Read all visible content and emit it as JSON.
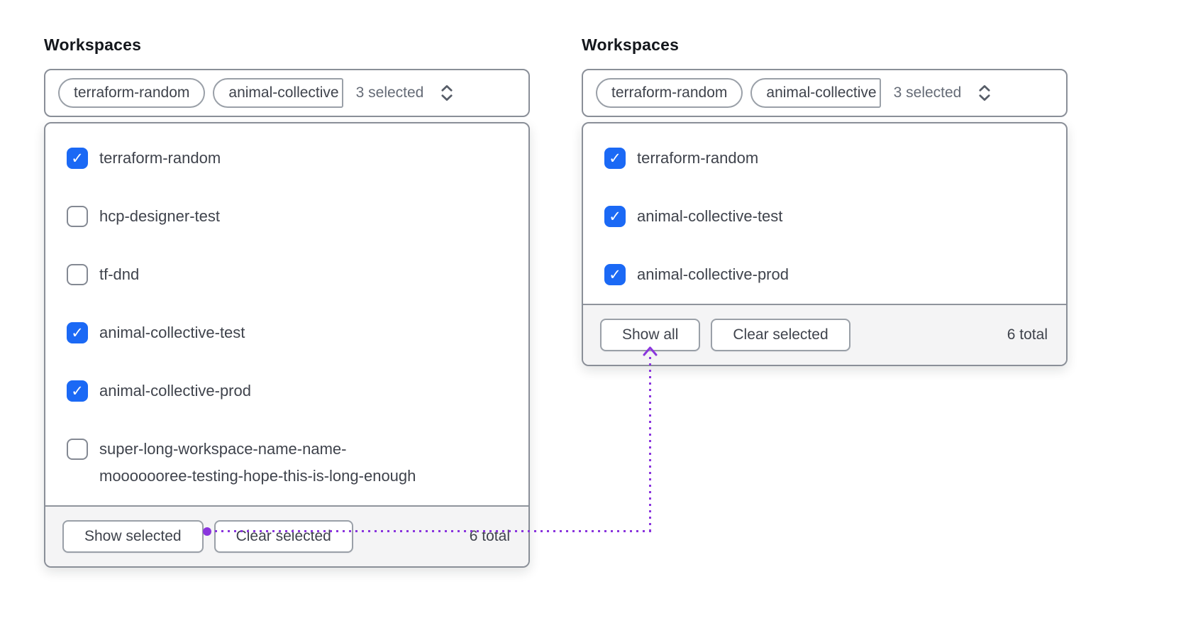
{
  "colors": {
    "checkbox_checked": "#1b69f5",
    "annotation_purple": "#8a35dd",
    "container_border": "#8a8f98",
    "footer_background": "#f4f4f5",
    "text_primary": "#3f434c",
    "text_muted": "#656b76"
  },
  "glyphs": {
    "check": "✓"
  },
  "panels": [
    {
      "label": "Workspaces",
      "toggle": {
        "pills": [
          {
            "label": "terraform-random",
            "truncated": false
          },
          {
            "label": "animal-collective",
            "truncated": true
          }
        ],
        "count": "3 selected"
      },
      "items": [
        {
          "label": "terraform-random",
          "checked": true
        },
        {
          "label": "hcp-designer-test",
          "checked": false
        },
        {
          "label": "tf-dnd",
          "checked": false
        },
        {
          "label": "animal-collective-test",
          "checked": true
        },
        {
          "label": "animal-collective-prod",
          "checked": true
        },
        {
          "label": "super-long-workspace-name-name-\nmooooooree-testing-hope-this-is-long-enough",
          "checked": false
        }
      ],
      "footer": {
        "primary": "Show selected",
        "secondary": "Clear selected",
        "total": "6 total"
      }
    },
    {
      "label": "Workspaces",
      "toggle": {
        "pills": [
          {
            "label": "terraform-random",
            "truncated": false
          },
          {
            "label": "animal-collective",
            "truncated": true
          }
        ],
        "count": "3 selected"
      },
      "items": [
        {
          "label": "terraform-random",
          "checked": true
        },
        {
          "label": "animal-collective-test",
          "checked": true
        },
        {
          "label": "animal-collective-prod",
          "checked": true
        }
      ],
      "footer": {
        "primary": "Show all",
        "secondary": "Clear selected",
        "total": "6 total"
      }
    }
  ]
}
